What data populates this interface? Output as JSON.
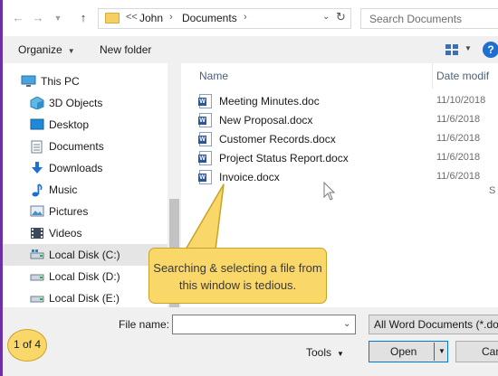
{
  "address": {
    "crumbs": [
      "John",
      "Documents"
    ],
    "overflow": "<<",
    "separator": "›"
  },
  "search": {
    "placeholder": "Search Documents"
  },
  "toolbar": {
    "organize_label": "Organize",
    "new_folder_label": "New folder",
    "help_label": "?"
  },
  "sidebar": {
    "items": [
      {
        "label": "This PC",
        "icon": "pc-icon"
      },
      {
        "label": "3D Objects",
        "icon": "3d-objects-icon"
      },
      {
        "label": "Desktop",
        "icon": "desktop-icon"
      },
      {
        "label": "Documents",
        "icon": "documents-icon"
      },
      {
        "label": "Downloads",
        "icon": "downloads-icon"
      },
      {
        "label": "Music",
        "icon": "music-icon"
      },
      {
        "label": "Pictures",
        "icon": "pictures-icon"
      },
      {
        "label": "Videos",
        "icon": "videos-icon"
      },
      {
        "label": "Local Disk (C:)",
        "icon": "drive-c-icon",
        "selected": true
      },
      {
        "label": "Local Disk (D:)",
        "icon": "drive-icon"
      },
      {
        "label": "Local Disk (E:)",
        "icon": "drive-icon"
      }
    ]
  },
  "file_list": {
    "columns": {
      "name": "Name",
      "date": "Date modif"
    },
    "files": [
      {
        "name": "Meeting Minutes.doc",
        "date": "11/10/2018"
      },
      {
        "name": "New Proposal.docx",
        "date": "11/6/2018"
      },
      {
        "name": "Customer Records.docx",
        "date": "11/6/2018"
      },
      {
        "name": "Project Status Report.docx",
        "date": "11/6/2018"
      },
      {
        "name": "Invoice.docx",
        "date": "11/6/2018"
      }
    ],
    "extra_col_text": "S"
  },
  "callout": {
    "text": "Searching & selecting a file from this window is tedious."
  },
  "bottom": {
    "file_name_label": "File name:",
    "file_name_value": "",
    "filter_value": "All Word Documents (*.doc",
    "tools_label": "Tools",
    "open_label": "Open",
    "cancel_label": "Can"
  },
  "step_badge": "1 of 4",
  "colors": {
    "accent": "#0078d7",
    "callout_fill": "#f9d769",
    "word_blue": "#2b579a",
    "folder_yellow": "#f3cf64"
  }
}
